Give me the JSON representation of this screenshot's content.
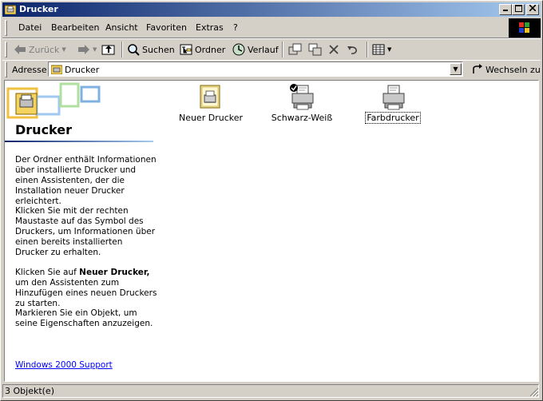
{
  "window": {
    "title": "Drucker"
  },
  "menu": [
    "Datei",
    "Bearbeiten",
    "Ansicht",
    "Favoriten",
    "Extras",
    "?"
  ],
  "toolbar": {
    "back": "Zurück",
    "search": "Suchen",
    "folders": "Ordner",
    "history": "Verlauf"
  },
  "address": {
    "label": "Adresse",
    "value": "Drucker",
    "go": "Wechseln zu"
  },
  "left_pane": {
    "title": "Drucker",
    "p1": "Der Ordner enthält Informationen über installierte Drucker und einen Assistenten, der die Installation neuer Drucker erleichtert.",
    "p2": "Klicken Sie mit der rechten Maustaste auf das Symbol des Druckers, um Informationen über einen bereits installierten Drucker zu erhalten.",
    "p3_pre": "Klicken Sie auf ",
    "p3_bold": "Neuer Drucker,",
    "p3_post": " um den Assistenten zum Hinzufügen eines neuen Druckers zu starten.",
    "p4": "Markieren Sie ein Objekt, um seine Eigenschaften anzuzeigen.",
    "link": "Windows 2000 Support"
  },
  "items": [
    {
      "label": "Neuer Drucker",
      "icon": "add-printer-icon"
    },
    {
      "label": "Schwarz-Weiß",
      "icon": "default-printer-icon"
    },
    {
      "label": "Farbdrucker",
      "icon": "printer-icon"
    }
  ],
  "status": {
    "text": "3 Objekt(e)"
  },
  "colors": {
    "title_start": "#0a246a",
    "title_end": "#a6caf0",
    "face": "#d4d0c8",
    "link": "#0000ff"
  }
}
